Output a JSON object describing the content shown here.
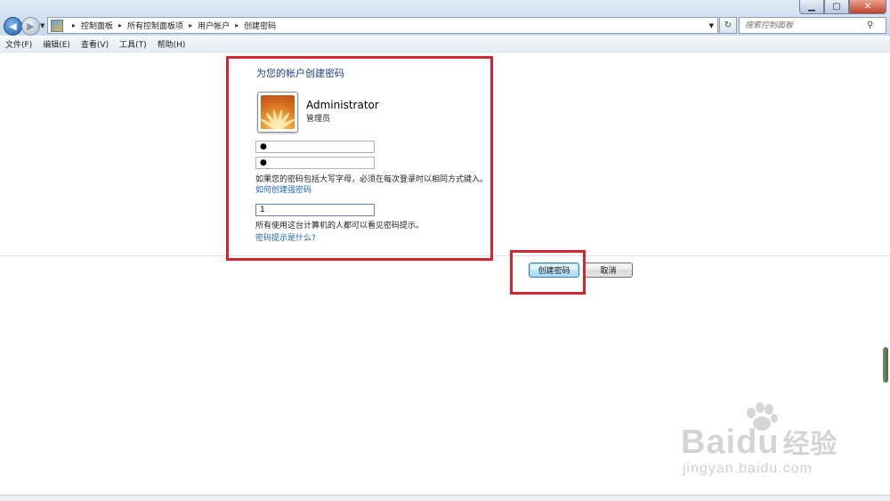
{
  "address_bar": {
    "breadcrumbs": [
      "控制面板",
      "所有控制面板项",
      "用户帐户",
      "创建密码"
    ],
    "separator": "▸"
  },
  "search": {
    "placeholder": "搜索控制面板"
  },
  "menu": [
    "文件(F)",
    "编辑(E)",
    "查看(V)",
    "工具(T)",
    "帮助(H)"
  ],
  "content": {
    "title": "为您的帐户创建密码",
    "user_name": "Administrator",
    "user_role": "管理员",
    "new_password_value": "●",
    "confirm_password_value": "●",
    "caps_hint": "如果您的密码包括大写字母，必须在每次登录时以相同方式键入。",
    "strong_password_link": "如何创建强密码",
    "password_hint_value": "1",
    "hint_visibility_note": "所有使用这台计算机的人都可以看见密码提示。",
    "what_is_hint_link": "密码提示是什么?"
  },
  "buttons": {
    "create": "创建密码",
    "cancel": "取消"
  },
  "icons": {
    "back": "back-arrow-icon",
    "forward": "forward-arrow-icon",
    "control_panel": "control-panel-icon",
    "refresh": "refresh-icon",
    "search": "search-icon"
  },
  "colors": {
    "annotation": "#d5262f",
    "link": "#1f62b5",
    "title": "#1e3f90"
  },
  "watermark": {
    "brand": "Baidu",
    "brand_cn": "经验",
    "url": "jingyan.baidu.com"
  }
}
